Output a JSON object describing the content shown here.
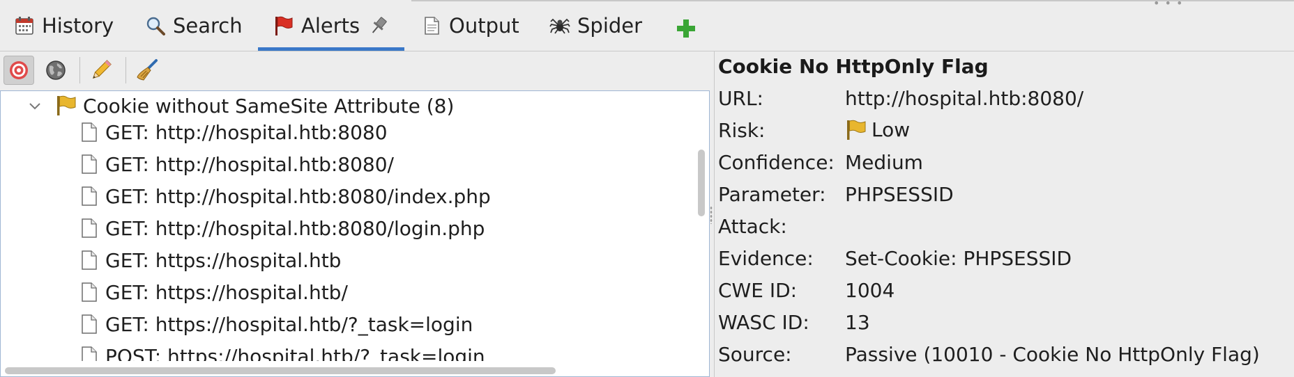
{
  "tabs": [
    {
      "label": "History",
      "icon": "calendar-icon"
    },
    {
      "label": "Search",
      "icon": "magnifier-icon"
    },
    {
      "label": "Alerts",
      "icon": "flag-icon",
      "extra_icon": "pin-icon",
      "active": true
    },
    {
      "label": "Output",
      "icon": "document-icon"
    },
    {
      "label": "Spider",
      "icon": "spider-icon"
    }
  ],
  "add_tab_icon": "plus-icon",
  "toolbar": {
    "buttons": [
      "target-icon",
      "globe-icon",
      "pencil-icon",
      "broom-icon"
    ]
  },
  "alert_tree": {
    "group_label": "Cookie without SameSite Attribute (8)",
    "items": [
      "GET: http://hospital.htb:8080",
      "GET: http://hospital.htb:8080/",
      "GET: http://hospital.htb:8080/index.php",
      "GET: http://hospital.htb:8080/login.php",
      "GET: https://hospital.htb",
      "GET: https://hospital.htb/",
      "GET: https://hospital.htb/?_task=login",
      "POST: https://hospital.htb/?_task=login"
    ]
  },
  "alert_detail": {
    "title": "Cookie No HttpOnly Flag",
    "url_label": "URL:",
    "url_value": "http://hospital.htb:8080/",
    "risk_label": "Risk:",
    "risk_value": "Low",
    "confidence_label": "Confidence:",
    "confidence_value": "Medium",
    "parameter_label": "Parameter:",
    "parameter_value": "PHPSESSID",
    "attack_label": "Attack:",
    "attack_value": "",
    "evidence_label": "Evidence:",
    "evidence_value": "Set-Cookie: PHPSESSID",
    "cwe_label": "CWE ID:",
    "cwe_value": "1004",
    "wasc_label": "WASC ID:",
    "wasc_value": "13",
    "source_label": "Source:",
    "source_value": "Passive (10010 - Cookie No HttpOnly Flag)"
  },
  "colors": {
    "active_tab_underline": "#3a78c8",
    "flag_yellow": "#e8b62e",
    "flag_red": "#d93025",
    "add_green": "#3aa535"
  }
}
